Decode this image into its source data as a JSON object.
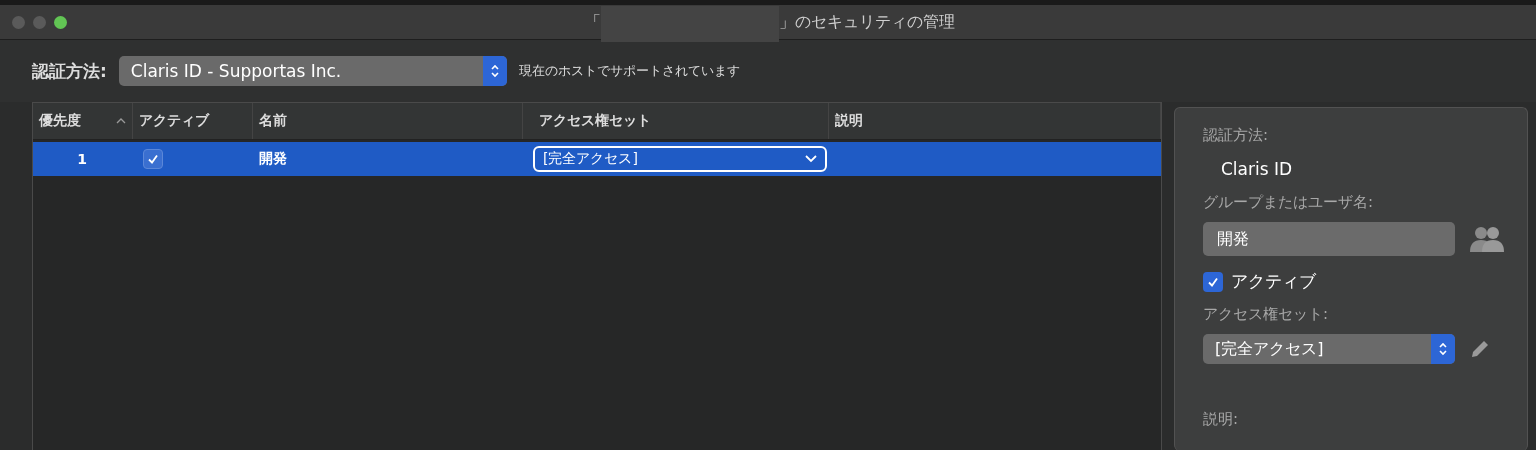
{
  "window": {
    "title_prefix": "「",
    "title_suffix": "」のセキュリティの管理"
  },
  "toolbar": {
    "label": "認証方法:",
    "auth_method": "Claris ID - Supportas Inc.",
    "note": "現在のホストでサポートされています"
  },
  "table": {
    "columns": [
      {
        "label": "優先度",
        "sorted": true
      },
      {
        "label": "アクティブ",
        "sorted": false
      },
      {
        "label": "名前",
        "sorted": false
      },
      {
        "label": "アクセス権セット",
        "sorted": false
      },
      {
        "label": "説明",
        "sorted": false
      }
    ],
    "rows": [
      {
        "priority": "1",
        "active": true,
        "name": "開発",
        "access_set": "[完全アクセス]",
        "selected": true
      }
    ]
  },
  "details": {
    "auth_label": "認証方法:",
    "auth_value": "Claris ID",
    "user_label": "グループまたはユーザ名:",
    "user_value": "開発",
    "active_label": "アクティブ",
    "active": true,
    "access_label": "アクセス権セット:",
    "access_value": "[完全アクセス]",
    "description_label": "説明:"
  }
}
